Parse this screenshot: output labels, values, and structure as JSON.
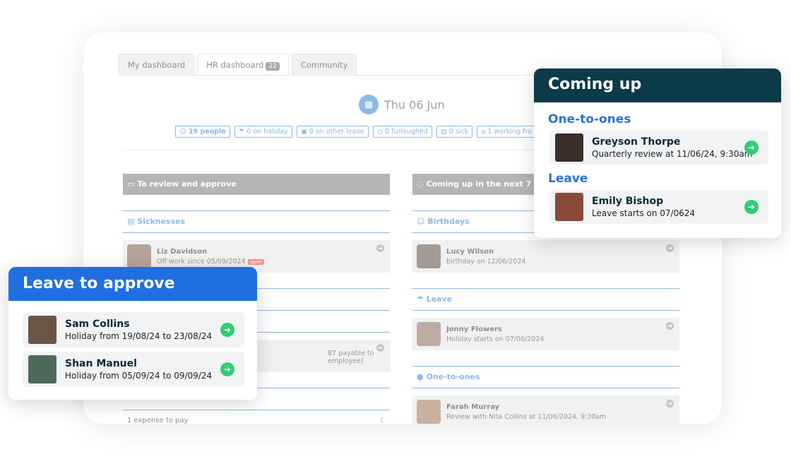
{
  "tabs": [
    {
      "label": "My dashboard"
    },
    {
      "label": "HR dashboard",
      "badge": "22"
    },
    {
      "label": "Community"
    }
  ],
  "date": "Thu 06 Jun",
  "stats": [
    "19 people",
    "0 on holiday",
    "0 on other leave",
    "0 furloughed",
    "0 sick",
    "1 working fro"
  ],
  "review_column": {
    "title": "To review and approve",
    "sicknesses_label": "Sicknesses",
    "sick_row": {
      "name": "Liz Davidson",
      "detail": "Off work since 05/09/2024",
      "badge": "open"
    },
    "row2_detail": "87 payable to employee)",
    "expense_text": "1 expense to pay",
    "expense_symbol": "£"
  },
  "coming_column": {
    "title": "Coming up in the next 7 da",
    "birthdays_label": "Birthdays",
    "birthday_row": {
      "name": "Lucy Wilson",
      "detail": "birthday on 12/06/2024"
    },
    "leave_label": "Leave",
    "leave_row": {
      "name": "Jonny Flowers",
      "detail": "Holiday starts on 07/06/2024"
    },
    "one_to_ones_label": "One-to-ones",
    "oto_row": {
      "name": "Farah Murray",
      "detail": "Review with Nita Collins at 11/06/2024, 9:30am"
    }
  },
  "leave_card": {
    "title": "Leave to approve",
    "header_color": "#1f6fe0",
    "items": [
      {
        "name": "Sam Collins",
        "detail": "Holiday from 19/08/24 to 23/08/24"
      },
      {
        "name": "Shan Manuel",
        "detail": "Holiday from 05/09/24 to 09/09/24"
      }
    ]
  },
  "coming_card": {
    "title": "Coming up",
    "header_color": "#0b3a48",
    "one_to_ones_label": "One-to-ones",
    "oto": {
      "name": "Greyson Thorpe",
      "detail": "Quarterly review at 11/06/24, 9:30am"
    },
    "leave_label": "Leave",
    "leave": {
      "name": "Emily Bishop",
      "detail": "Leave starts on 07/0624"
    }
  },
  "icons": {
    "arrow": "arrow-right-icon",
    "calendar": "calendar-icon"
  },
  "accent_green": "#2fcf73"
}
